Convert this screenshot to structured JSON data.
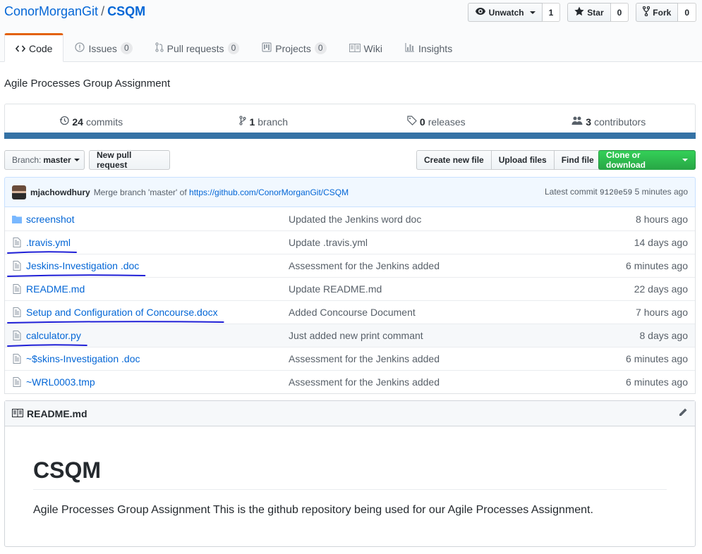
{
  "repo": {
    "owner": "ConorMorganGit",
    "separator": "/",
    "name": "CSQM"
  },
  "actions": {
    "watch_label": "Unwatch",
    "watch_count": "1",
    "star_label": "Star",
    "star_count": "0",
    "fork_label": "Fork",
    "fork_count": "0"
  },
  "nav": {
    "code": "Code",
    "issues": "Issues",
    "issues_count": "0",
    "pulls": "Pull requests",
    "pulls_count": "0",
    "projects": "Projects",
    "projects_count": "0",
    "wiki": "Wiki",
    "insights": "Insights"
  },
  "description": "Agile Processes Group Assignment",
  "summary": {
    "commits_num": "24",
    "commits_label": "commits",
    "branch_num": "1",
    "branch_label": "branch",
    "releases_num": "0",
    "releases_label": "releases",
    "contributors_num": "3",
    "contributors_label": "contributors"
  },
  "language_color": "#3572a5",
  "toolbar": {
    "branch_prefix": "Branch:",
    "branch_name": "master",
    "new_pr": "New pull request",
    "create_file": "Create new file",
    "upload_files": "Upload files",
    "find_file": "Find file",
    "clone": "Clone or download"
  },
  "commit": {
    "author": "mjachowdhury",
    "message": "Merge branch 'master' of",
    "link": "https://github.com/ConorMorganGit/CSQM",
    "latest_label": "Latest commit",
    "sha": "9120e59",
    "age": "5 minutes ago"
  },
  "files": [
    {
      "type": "folder",
      "name": "screenshot",
      "message": "Updated the Jenkins word doc",
      "age": "8 hours ago",
      "underlined": false,
      "highlight": false
    },
    {
      "type": "file",
      "name": ".travis.yml",
      "message": "Update .travis.yml",
      "age": "14 days ago",
      "underlined": true,
      "highlight": false
    },
    {
      "type": "file",
      "name": "Jeskins-Investigation .doc",
      "message": "Assessment for the Jenkins added",
      "age": "6 minutes ago",
      "underlined": true,
      "highlight": false
    },
    {
      "type": "file",
      "name": "README.md",
      "message": "Update README.md",
      "age": "22 days ago",
      "underlined": false,
      "highlight": false
    },
    {
      "type": "file",
      "name": "Setup and Configuration of Concourse.docx",
      "message": "Added Concourse Document",
      "age": "7 hours ago",
      "underlined": true,
      "highlight": false
    },
    {
      "type": "file",
      "name": "calculator.py",
      "message": "Just added new print commant",
      "age": "8 days ago",
      "underlined": true,
      "highlight": true
    },
    {
      "type": "file",
      "name": "~$skins-Investigation .doc",
      "message": "Assessment for the Jenkins added",
      "age": "6 minutes ago",
      "underlined": false,
      "highlight": false
    },
    {
      "type": "file",
      "name": "~WRL0003.tmp",
      "message": "Assessment for the Jenkins added",
      "age": "6 minutes ago",
      "underlined": false,
      "highlight": false
    }
  ],
  "readme": {
    "filename": "README.md",
    "heading": "CSQM",
    "body": "Agile Processes Group Assignment This is the github repository being used for our Agile Processes Assignment."
  }
}
